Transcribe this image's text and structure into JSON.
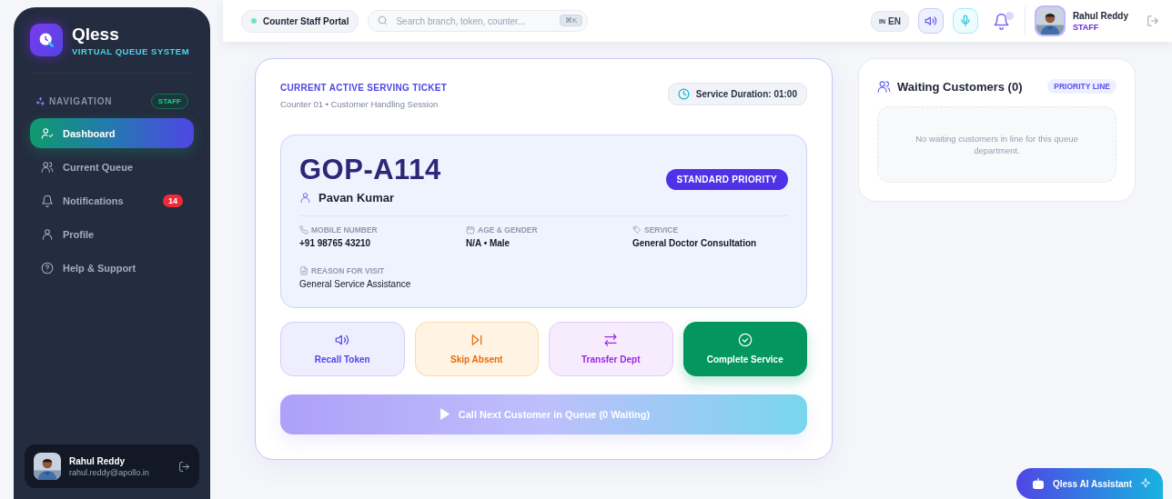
{
  "brand": {
    "name": "Qless",
    "tagline": "VIRTUAL QUEUE SYSTEM"
  },
  "sidebar": {
    "section_label": "NAVIGATION",
    "role_badge": "STAFF",
    "items": [
      {
        "label": "Dashboard",
        "selected": true
      },
      {
        "label": "Current Queue",
        "selected": false
      },
      {
        "label": "Notifications",
        "selected": false,
        "badge": "14"
      },
      {
        "label": "Profile",
        "selected": false
      },
      {
        "label": "Help & Support",
        "selected": false
      }
    ]
  },
  "user_card": {
    "name": "Rahul Reddy",
    "email": "rahul.reddy@apollo.in"
  },
  "topbar": {
    "portal": "Counter Staff Portal",
    "search_placeholder": "Search branch, token, counter...",
    "shortcut": "⌘K",
    "language": {
      "flag": "IN",
      "code": "EN"
    },
    "user": {
      "name": "Rahul Reddy",
      "role": "STAFF"
    }
  },
  "ticket_panel": {
    "eyebrow": "CURRENT ACTIVE SERVING TICKET",
    "subtitle": "Counter 01 • Customer Handling Session",
    "duration": "Service Duration: 01:00",
    "token": "GOP-A114",
    "customer": "Pavan Kumar",
    "priority": "STANDARD PRIORITY",
    "fields": [
      {
        "label": "MOBILE NUMBER",
        "value": "+91 98765 43210",
        "kind": "phone"
      },
      {
        "label": "AGE & GENDER",
        "value": "N/A • Male",
        "kind": "calendar"
      },
      {
        "label": "SERVICE",
        "value": "General Doctor Consultation",
        "kind": "tag"
      },
      {
        "label": "REASON FOR VISIT",
        "value": "General Service Assistance",
        "kind": "document"
      }
    ],
    "actions": [
      {
        "label": "Recall Token",
        "kind": "recall"
      },
      {
        "label": "Skip Absent",
        "kind": "skip"
      },
      {
        "label": "Transfer Dept",
        "kind": "transfer"
      },
      {
        "label": "Complete Service",
        "kind": "complete"
      }
    ],
    "call_next": {
      "label": "Call Next Customer in Queue (0 Waiting)",
      "disabled": true
    }
  },
  "waiting": {
    "title": "Waiting Customers (0)",
    "badge": "PRIORITY LINE",
    "empty_text": "No waiting customers in line for this queue department."
  },
  "assistant_button": "Qless AI Assistant"
}
